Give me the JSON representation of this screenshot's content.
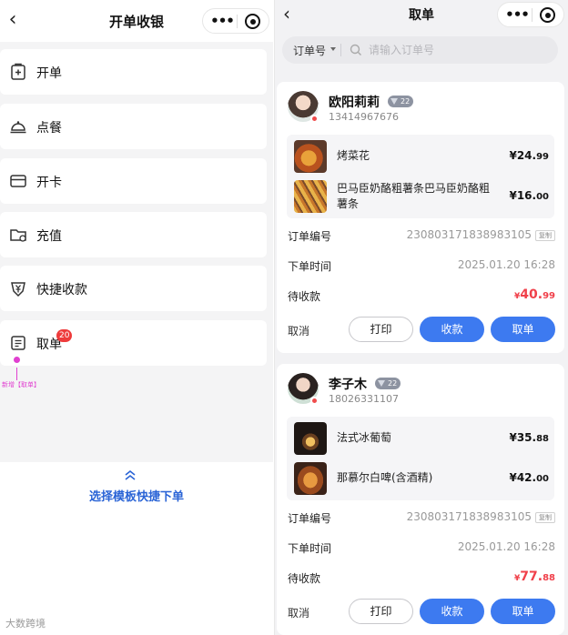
{
  "left_panel": {
    "title": "开单收银",
    "menu": [
      {
        "label": "开单",
        "icon": "plus-document-icon"
      },
      {
        "label": "点餐",
        "icon": "food-cloche-icon"
      },
      {
        "label": "开卡",
        "icon": "card-icon"
      },
      {
        "label": "充值",
        "icon": "recharge-folder-icon"
      },
      {
        "label": "快捷收款",
        "icon": "yen-shield-icon"
      },
      {
        "label": "取单",
        "icon": "pickup-tray-icon",
        "badge": "20"
      }
    ],
    "annotation": "新增【取单】",
    "template_link": "选择模板快捷下单",
    "watermark": "大数跨境"
  },
  "right_panel": {
    "title": "取单",
    "search": {
      "selector": "订单号",
      "placeholder": "请输入订单号"
    },
    "labels": {
      "order_no": "订单编号",
      "order_time": "下单时间",
      "pending": "待收款",
      "copy": "复制",
      "cancel": "取消",
      "print": "打印",
      "collect": "收款",
      "take": "取单"
    },
    "orders": [
      {
        "customer": "欧阳莉莉",
        "level": "22",
        "phone": "13414967676",
        "items": [
          {
            "name": "烤菜花",
            "price_int": "¥24.",
            "price_dec": "99"
          },
          {
            "name": "巴马臣奶酪粗薯条巴马臣奶酪粗薯条",
            "price_int": "¥16.",
            "price_dec": "00"
          }
        ],
        "order_no": "230803171838983105",
        "order_time": "2025.01.20 16:28",
        "amount_cur": "¥",
        "amount_int": "40.",
        "amount_dec": "99"
      },
      {
        "customer": "李子木",
        "level": "22",
        "phone": "18026331107",
        "items": [
          {
            "name": "法式冰葡萄",
            "price_int": "¥35.",
            "price_dec": "88"
          },
          {
            "name": "那慕尔白啤(含酒精)",
            "price_int": "¥42.",
            "price_dec": "00"
          }
        ],
        "order_no": "230803171838983105",
        "order_time": "2025.01.20 16:28",
        "amount_cur": "¥",
        "amount_int": "77.",
        "amount_dec": "88"
      }
    ]
  },
  "colors": {
    "accent_blue": "#3d7af0",
    "link_blue": "#2a64d6",
    "amount_red": "#f0404a",
    "badge_red": "#ee3b3b",
    "annotation_pink": "#e040d0"
  }
}
